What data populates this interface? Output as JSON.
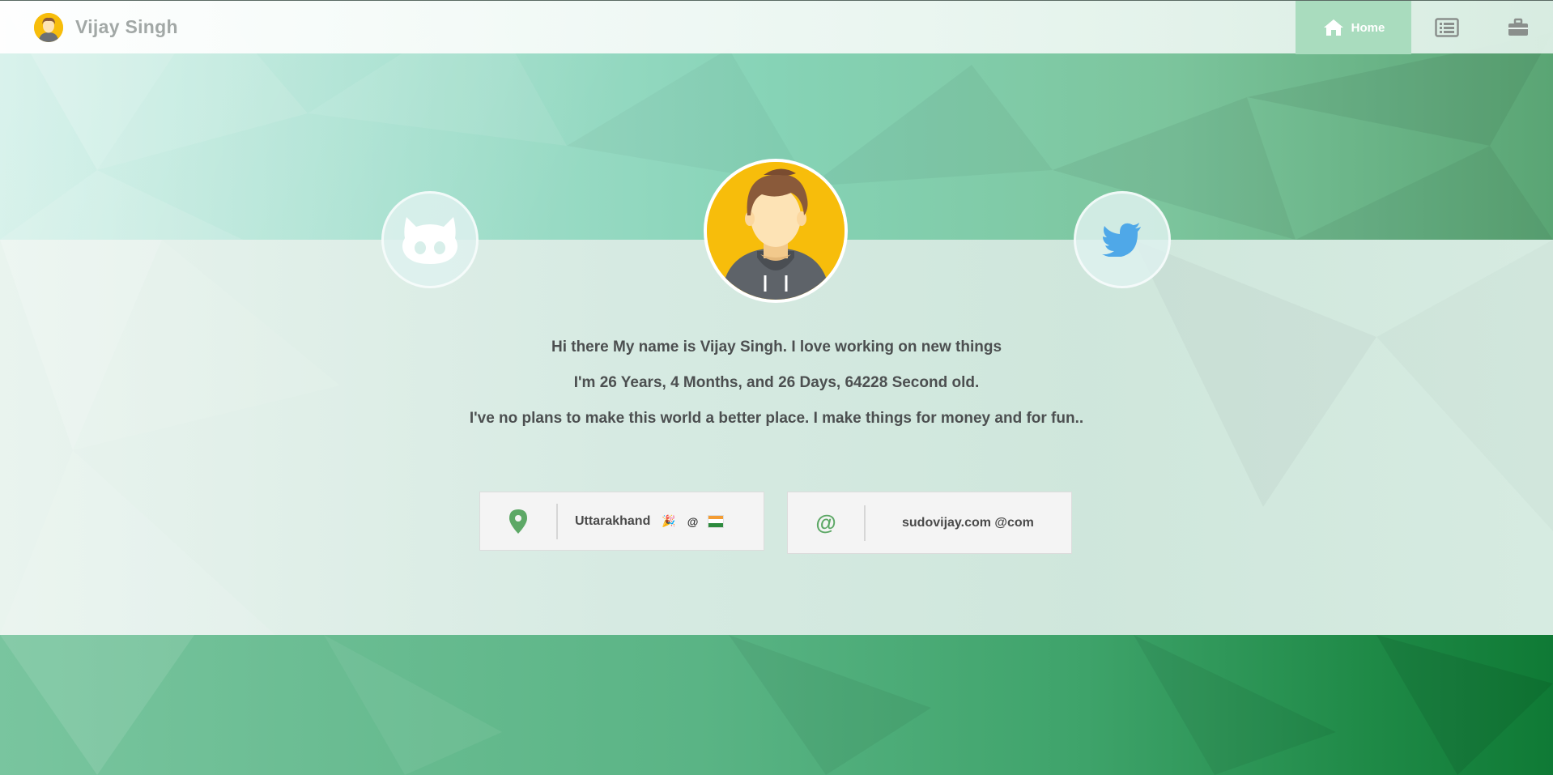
{
  "header": {
    "title": "Vijay Singh",
    "nav": [
      {
        "label": "Home",
        "icon": "home-icon",
        "active": true
      },
      {
        "label": "",
        "icon": "resume-list-icon",
        "active": false
      },
      {
        "label": "",
        "icon": "briefcase-icon",
        "active": false
      }
    ]
  },
  "social": {
    "github_icon": "github-icon",
    "twitter_icon": "twitter-icon"
  },
  "intro": {
    "line1": "Hi there My name is Vijay Singh. I love working on new things",
    "line2": "I'm 26 Years, 4 Months, and 26 Days, 64228 Second old.",
    "line3": "I've no plans to make this world a better place. I make things for money and for fun.."
  },
  "location": {
    "icon": "map-pin-icon",
    "text": "Uttarakhand",
    "emoji": "🎉",
    "at": "@",
    "flag_icon": "india-flag-icon"
  },
  "email": {
    "icon": "at-icon",
    "at_symbol": "@",
    "text": "sudovijay.com @com"
  },
  "colors": {
    "accent": "#a9dcbe",
    "avatar_bg": "#f7bd0b",
    "pin_green": "#5da866",
    "twitter_blue": "#4fa8e8",
    "text": "#4c4f50"
  }
}
